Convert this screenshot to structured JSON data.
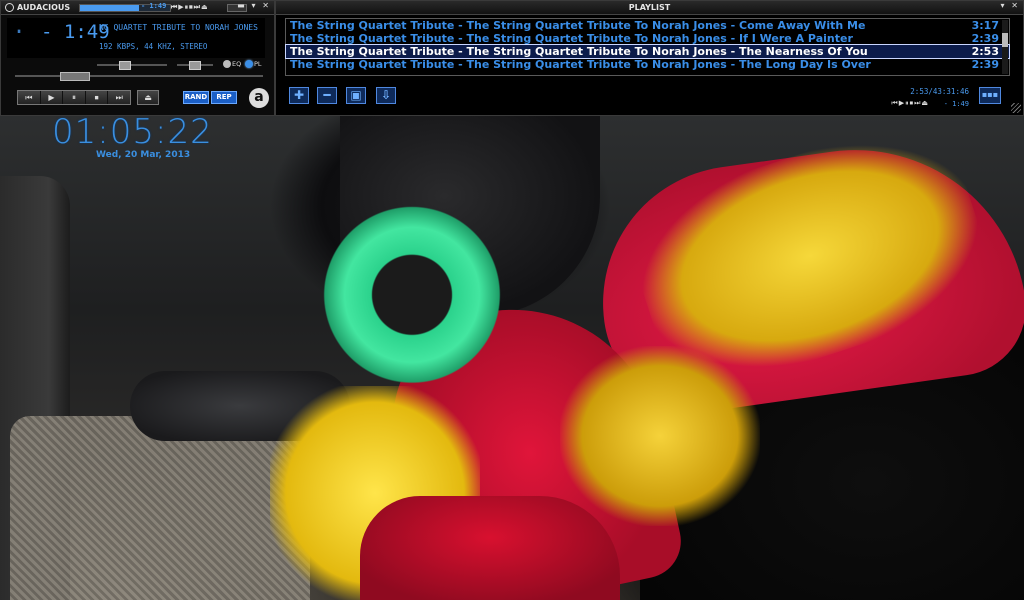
{
  "main_window": {
    "title": "AUDACIOUS",
    "mini_time": "- 1:49",
    "mini_controls": "⏮▶⏸⏹⏭⏏",
    "window_buttons": "▬ ▾ ✕",
    "status_icon": "⏸",
    "elapsed": "- 1:49",
    "ticker": "NG QUARTET TRIBUTE TO NORAH JONES",
    "info": "192 KBPS, 44 KHZ, STEREO",
    "seek_progress": 0.66,
    "eq_label": "EQ",
    "pl_label": "PL",
    "transport": [
      "⏮",
      "▶",
      "⏸",
      "⏹",
      "⏭"
    ],
    "eject": "⏏",
    "shuffle_label": "RAND",
    "repeat_label": "REP",
    "logo": "a"
  },
  "playlist": {
    "title": "PLAYLIST",
    "window_buttons": "▾ ✕",
    "tracks": [
      {
        "title": "The String Quartet Tribute - The String Quartet Tribute To Norah Jones - Come Away With Me",
        "duration": "3:17",
        "selected": false
      },
      {
        "title": "The String Quartet Tribute - The String Quartet Tribute To Norah Jones - If I Were A Painter",
        "duration": "2:39",
        "selected": false
      },
      {
        "title": "The String Quartet Tribute - The String Quartet Tribute To Norah Jones - The Nearness Of You",
        "duration": "2:53",
        "selected": true
      },
      {
        "title": "The String Quartet Tribute - The String Quartet Tribute To Norah Jones - The Long Day Is Over",
        "duration": "2:39",
        "selected": false
      }
    ],
    "add_icon": "✚",
    "remove_icon": "━",
    "select_icon": "▣",
    "misc_icon": "⇩",
    "status": "2:53/43:31:46",
    "mini_controls": "⏮▶⏸⏹⏭⏏",
    "mini_time": "- 1:49",
    "menu_icon": "▪▪▪"
  },
  "desktop_clock": {
    "time": "01:05:22",
    "date": "Wed, 20 Mar, 2013"
  },
  "colors": {
    "accent": "#3a8ee8",
    "selection_bg": "#0b1b4a",
    "button_bg": "#1b5fc6"
  }
}
